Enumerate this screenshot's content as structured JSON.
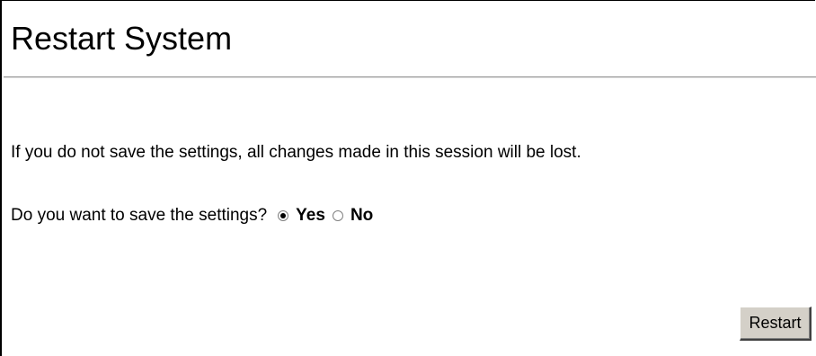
{
  "page": {
    "title": "Restart System"
  },
  "notice": {
    "text": "If you do not save the settings, all changes made in this session will be lost."
  },
  "save_prompt": {
    "question": "Do you want to save the settings?",
    "options": [
      {
        "label": "Yes",
        "checked": true
      },
      {
        "label": "No",
        "checked": false
      }
    ],
    "selected": "Yes"
  },
  "actions": {
    "restart_label": "Restart"
  }
}
